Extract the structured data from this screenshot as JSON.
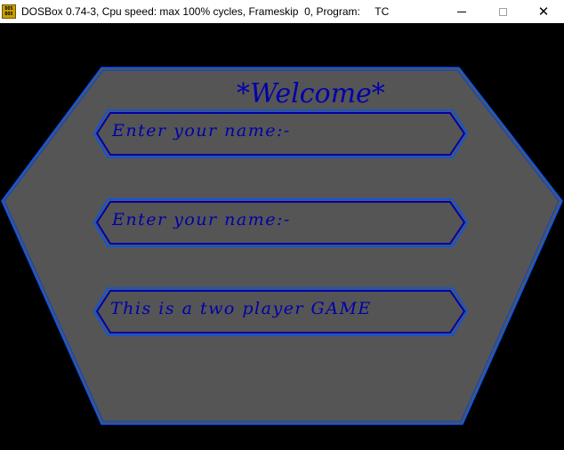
{
  "window": {
    "title": "DOSBox 0.74-3, Cpu speed: max 100% cycles, Frameskip  0, Program:     TC",
    "icon_text": "DOS\nBOX",
    "minimize_icon": "minimize-icon",
    "maximize_icon": "maximize-icon",
    "close_symbol": "✕"
  },
  "screen": {
    "welcome": "*Welcome*",
    "fields": [
      {
        "text": "Enter your name:-"
      },
      {
        "text": "Enter your name:-"
      },
      {
        "text": "This is a two player GAME"
      }
    ]
  },
  "colors": {
    "background": "#000000",
    "panel": "#555555",
    "border": "#0055ff",
    "text": "#0000aa"
  }
}
